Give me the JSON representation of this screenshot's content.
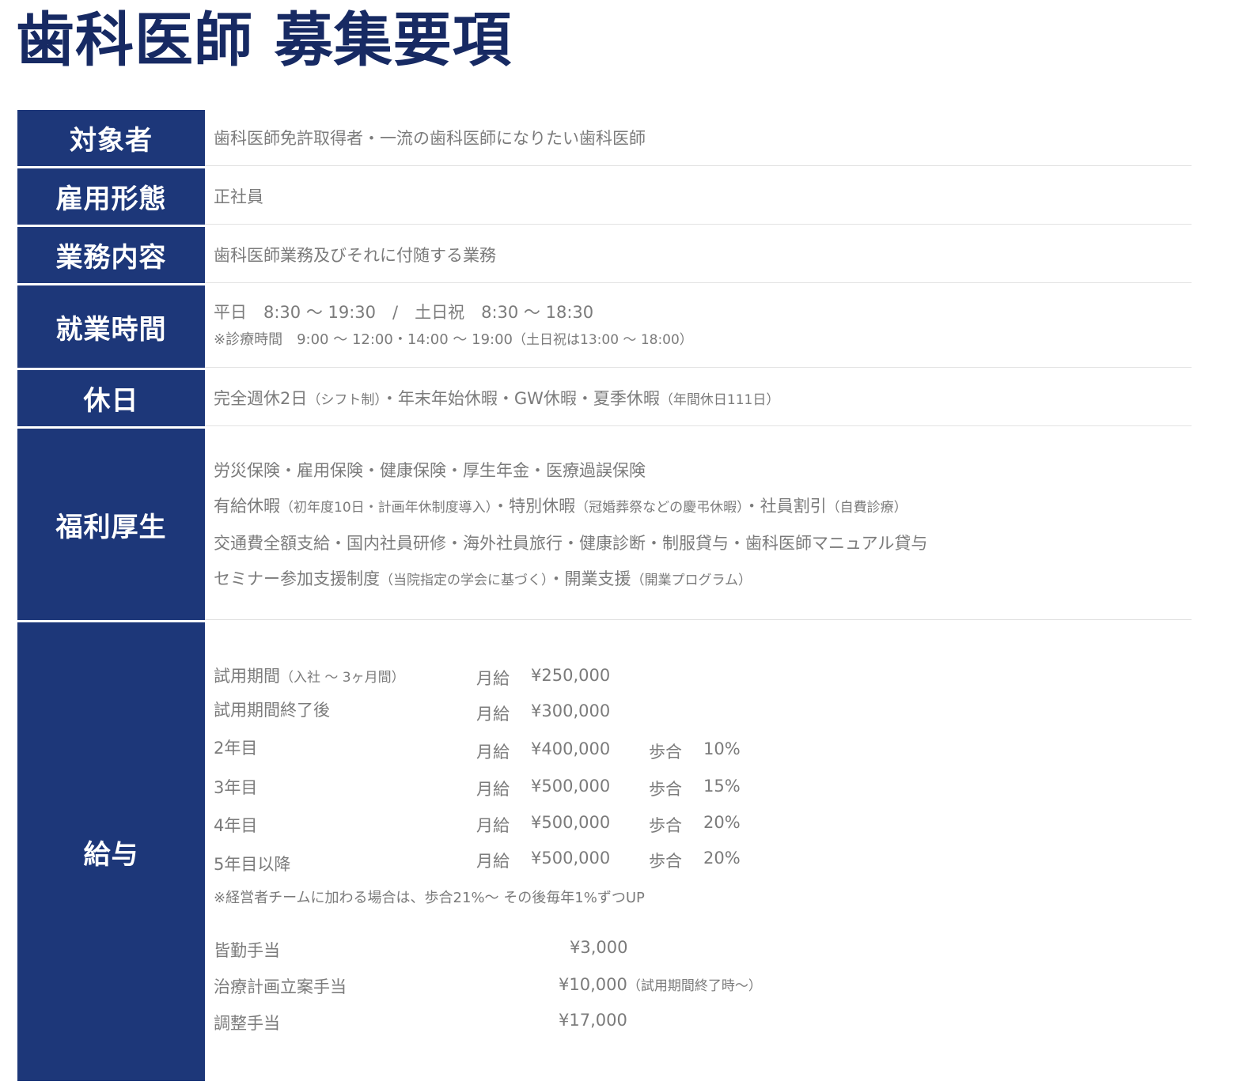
{
  "page": {
    "title": "歯科医師 募集要項"
  },
  "rows": {
    "target": {
      "label": "対象者",
      "value": "歯科医師免許取得者・一流の歯科医師になりたい歯科医師"
    },
    "employment": {
      "label": "雇用形態",
      "value": "正社員"
    },
    "duties": {
      "label": "業務内容",
      "value": "歯科医師業務及びそれに付随する業務"
    },
    "hours": {
      "label": "就業時間",
      "line1": "平日　8:30 〜 19:30　/　土日祝　8:30 〜 18:30",
      "line2": "※診療時間　9:00 〜 12:00・14:00 〜 19:00",
      "line2_note": "（土日祝は13:00 〜 18:00）"
    },
    "holidays": {
      "label": "休日",
      "part1": "完全週休2日",
      "part1_note": "（シフト制）",
      "part2": "・年末年始休暇・GW休暇・夏季休暇",
      "part2_note": "（年間休日111日）"
    },
    "welfare": {
      "label": "福利厚生",
      "line1": "労災保険・雇用保険・健康保険・厚生年金・医療過誤保険",
      "line2_a": "有給休暇",
      "line2_a_note": "（初年度10日・計画年休制度導入）",
      "line2_b": "・特別休暇",
      "line2_b_note": "（冠婚葬祭などの慶弔休暇）",
      "line2_c": "・社員割引",
      "line2_c_note": "（自費診療）",
      "line3": "交通費全額支給・国内社員研修・海外社員旅行・健康診断・制服貸与・歯科医師マニュアル貸与",
      "line4_a": "セミナー参加支援制度",
      "line4_a_note": "（当院指定の学会に基づく）",
      "line4_b": "・開業支援",
      "line4_b_note": "（開業プログラム）"
    },
    "salary": {
      "label": "給与",
      "monthly_label": "月給",
      "rate_label": "歩合",
      "tiers": [
        {
          "label": "試用期間",
          "label_note": "（入社 〜 3ヶ月間）",
          "amount": "¥250,000",
          "rate": ""
        },
        {
          "label": "試用期間終了後",
          "label_note": "",
          "amount": "¥300,000",
          "rate": ""
        },
        {
          "label": "2年目",
          "label_note": "",
          "amount": "¥400,000",
          "rate": "10%"
        },
        {
          "label": "3年目",
          "label_note": "",
          "amount": "¥500,000",
          "rate": "15%"
        },
        {
          "label": "4年目",
          "label_note": "",
          "amount": "¥500,000",
          "rate": "20%"
        },
        {
          "label": "5年目以降",
          "label_note": "",
          "amount": "¥500,000",
          "rate": "20%"
        }
      ],
      "note": "※経営者チームに加わる場合は、歩合21%〜 その後毎年1%ずつUP",
      "allowances": [
        {
          "label": "皆勤手当",
          "amount": "¥3,000",
          "amount_note": ""
        },
        {
          "label": "治療計画立案手当",
          "amount": "¥10,000",
          "amount_note": "（試用期間終了時〜）"
        },
        {
          "label": "調整手当",
          "amount": "¥17,000",
          "amount_note": ""
        }
      ]
    }
  }
}
